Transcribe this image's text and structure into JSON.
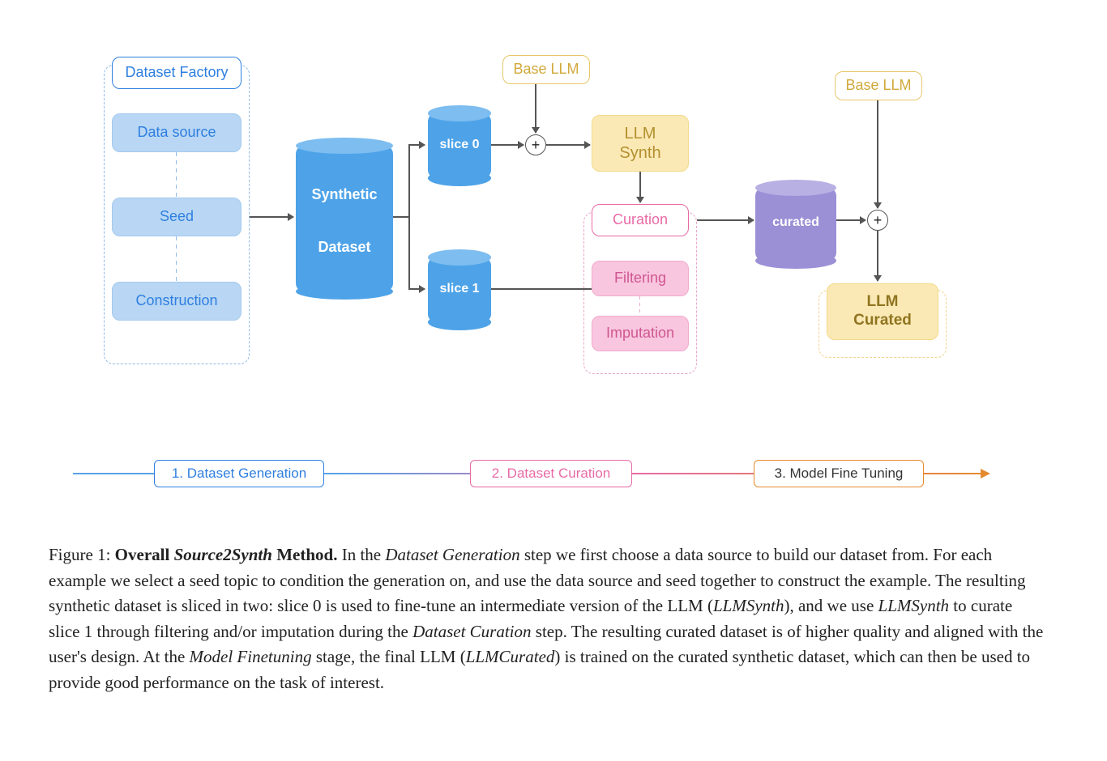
{
  "factory": {
    "title": "Dataset Factory",
    "items": [
      "Data source",
      "Seed",
      "Construction"
    ]
  },
  "synthetic": {
    "line1": "Synthetic",
    "line2": "Dataset"
  },
  "slice0": "slice 0",
  "slice1": "slice 1",
  "base_llm": "Base LLM",
  "llm_synth": {
    "line1": "LLM",
    "line2": "Synth"
  },
  "curation": "Curation",
  "filtering": "Filtering",
  "imputation": "Imputation",
  "curated": "curated",
  "llm_curated": {
    "line1": "LLM",
    "line2": "Curated"
  },
  "stages": {
    "s1": "1. Dataset Generation",
    "s2": "2. Dataset Curation",
    "s3": "3. Model Fine Tuning"
  },
  "caption": {
    "lead": "Figure 1: ",
    "bold": "Overall ",
    "italic": "Source2Synth",
    "bold2": " Method.",
    "rest1": " In the ",
    "i1": "Dataset Generation",
    "rest2": " step we first choose a data source to build our dataset from. For each example we select a seed topic to condition the generation on, and use the data source and seed together to construct the example. The resulting synthetic dataset is sliced in two: slice 0 is used to fine-tune an intermediate version of the LLM (",
    "i2": "LLMSynth",
    "rest3": "), and we use ",
    "i3": "LLMSynth",
    "rest4": " to curate slice 1 through filtering and/or imputation during the ",
    "i4": "Dataset Curation",
    "rest5": " step. The resulting curated dataset is of higher quality and aligned with the user's design. At the ",
    "i5": "Model Finetuning",
    "rest6": " stage, the final LLM (",
    "i6": "LLMCurated",
    "rest7": ") is trained on the curated synthetic dataset, which can then be used to provide good performance on the task of interest."
  }
}
